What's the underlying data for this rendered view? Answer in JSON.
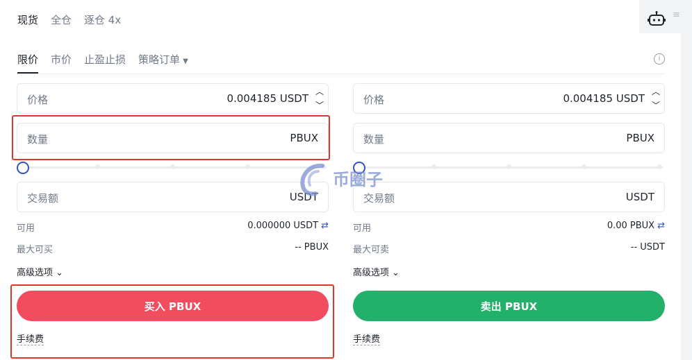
{
  "top_tabs": [
    {
      "label": "现货",
      "active": true
    },
    {
      "label": "全仓",
      "active": false
    },
    {
      "label": "逐仓 4x",
      "active": false
    }
  ],
  "order_tabs": [
    {
      "label": "限价",
      "active": true
    },
    {
      "label": "市价",
      "active": false
    },
    {
      "label": "止盈止损",
      "active": false
    },
    {
      "label": "策略订单",
      "active": false
    }
  ],
  "buy": {
    "price_label": "价格",
    "price_value": "0.004185 USDT",
    "qty_label": "数量",
    "qty_unit": "PBUX",
    "slider_fraction": 0,
    "amount_label": "交易额",
    "amount_unit": "USDT",
    "available_label": "可用",
    "available_value": "0.000000 USDT",
    "max_label": "最大可买",
    "max_value": "-- PBUX",
    "advanced_label": "高级选项",
    "button_label": "买入 PBUX",
    "fee_label": "手续费"
  },
  "sell": {
    "price_label": "价格",
    "price_value": "0.004185 USDT",
    "qty_label": "数量",
    "qty_unit": "PBUX",
    "slider_fraction": 0,
    "amount_label": "交易额",
    "amount_unit": "USDT",
    "available_label": "可用",
    "available_value": "0.00 PBUX",
    "max_label": "最大可卖",
    "max_value": "-- USDT",
    "advanced_label": "高级选项",
    "button_label": "卖出 PBUX",
    "fee_label": "手续费"
  },
  "watermark_text": "币圈子",
  "icons": {
    "robot": "robot-icon",
    "info": "info-icon",
    "swap": "swap-icon",
    "up": "chevron-up-icon",
    "down": "chevron-down-icon"
  },
  "colors": {
    "buy": "#f24c61",
    "sell": "#23b06a",
    "accent": "#2f50c8",
    "highlight": "#e0352b"
  }
}
